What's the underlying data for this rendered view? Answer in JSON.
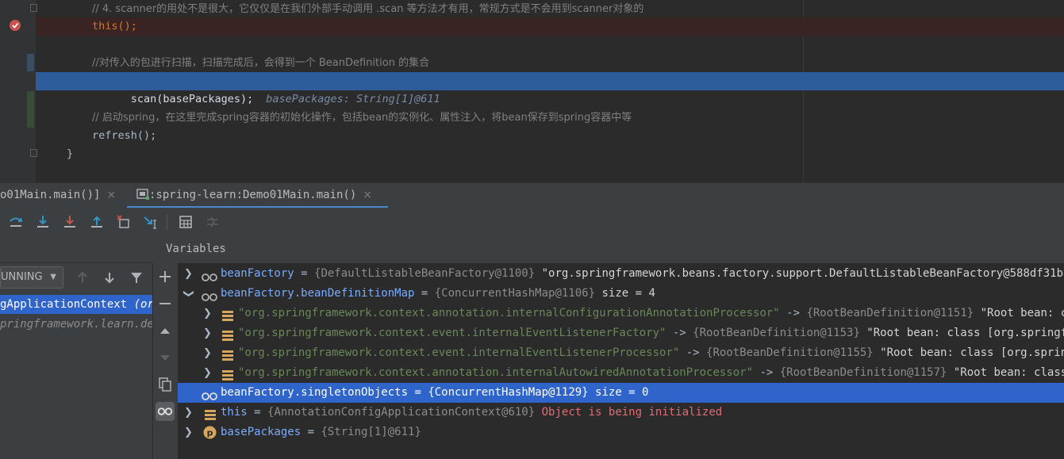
{
  "editor": {
    "lines": {
      "comment1": "// 4. scanner的用处不是很大，它仅仅是在我们外部手动调用 .scan 等方法才有用，常规方式是不会用到scanner对象的",
      "this_call": "this();",
      "comment2": "//对传入的包进行扫描，扫描完成后，会得到一个 BeanDefinition 的集合",
      "scan_call": "scan(basePackages);",
      "scan_hint": "basePackages: String[1]@611",
      "comment3": "// 启动spring，在这里完成spring容器的初始化操作，包括bean的实例化、属性注入，将bean保存到spring容器中等",
      "refresh_call": "refresh();",
      "brace": "}"
    }
  },
  "tabs": [
    {
      "label": "o01Main.main()]",
      "close": "×"
    },
    {
      "label": ":spring-learn:Demo01Main.main()",
      "close": "×"
    }
  ],
  "frames": {
    "status": "UNNING",
    "items": [
      {
        "label": "gApplicationContext",
        "suffix": "(or"
      },
      {
        "label": "pringframework.learn.dem"
      }
    ]
  },
  "variables": {
    "header": "Variables",
    "rows": [
      {
        "name": "beanFactory",
        "eq": " = ",
        "ref": "{DefaultListableBeanFactory@1100}",
        "text": " \"org.springframework.beans.factory.support.DefaultListableBeanFactory@588df31b:"
      },
      {
        "name": "beanFactory.beanDefinitionMap",
        "eq": " = ",
        "ref": "{ConcurrentHashMap@1106}",
        "size": "  size = 4"
      },
      {
        "key": "\"org.springframework.context.annotation.internalConfigurationAnnotationProcessor\"",
        "arrow": " -> ",
        "ref": "{RootBeanDefinition@1151}",
        "text": " \"Root bean: c"
      },
      {
        "key": "\"org.springframework.context.event.internalEventListenerFactory\"",
        "arrow": " -> ",
        "ref": "{RootBeanDefinition@1153}",
        "text": " \"Root bean: class [org.springf"
      },
      {
        "key": "\"org.springframework.context.event.internalEventListenerProcessor\"",
        "arrow": " -> ",
        "ref": "{RootBeanDefinition@1155}",
        "text": " \"Root bean: class [org.sprin"
      },
      {
        "key": "\"org.springframework.context.annotation.internalAutowiredAnnotationProcessor\"",
        "arrow": " -> ",
        "ref": "{RootBeanDefinition@1157}",
        "text": " \"Root bean: class"
      },
      {
        "name": "beanFactory.singletonObjects",
        "eq": " = ",
        "ref": "{ConcurrentHashMap@1129}",
        "size": "  size = 0"
      },
      {
        "name": "this",
        "eq": " = ",
        "ref": "{AnnotationConfigApplicationContext@610}",
        "text": " Object is being initialized"
      },
      {
        "name": "basePackages",
        "eq": " = ",
        "ref": "{String[1]@611}"
      }
    ]
  },
  "colors": {
    "exec_line": "#2d5c9a",
    "selection": "#2f65ca",
    "keyword": "#cc7832",
    "comment": "#808080"
  }
}
